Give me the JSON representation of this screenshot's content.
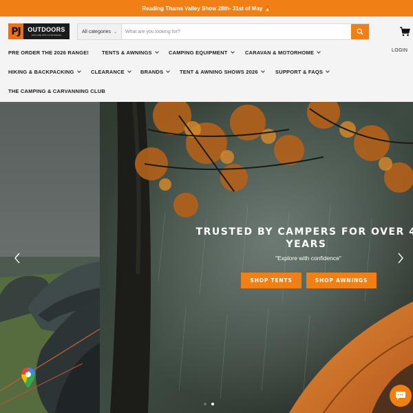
{
  "announcement": "Reading Thams Valley Show 28th- 31st of May 🔥",
  "logo": {
    "mark": "PJ",
    "name": "OUTDOORS",
    "tagline": "EXPLORE WITH CONFIDENCE"
  },
  "search": {
    "category": "All categories",
    "placeholder": "What are you looking for?"
  },
  "nav": {
    "row1": [
      "PRE ORDER THE 2026 RANGE!",
      "TENTS & AWNINGS",
      "CAMPING EQUIPMENT",
      "CARAVAN & MOTORHOME"
    ],
    "row2": [
      "HIKING & BACKPACKING",
      "CLEARANCE",
      "BRANDS",
      "TENT & AWNING SHOWS 2026",
      "SUPPORT & FAQS"
    ],
    "row3": [
      "THE CAMPING & CARVANNING CLUB"
    ],
    "login": "LOGIN"
  },
  "hero": {
    "title_line1": "TRUSTED BY CAMPERS FOR OVER 4",
    "title_line2": "YEARS",
    "subtitle": "\"Explore with confidence\"",
    "buttons": [
      "SHOP TENTS",
      "SHOP AWNINGS"
    ],
    "active_slide": 2,
    "slide_count": 2
  },
  "colors": {
    "accent": "#f07f16",
    "header_bg": "#f4f4f4"
  },
  "icons": [
    "search-icon",
    "cart-icon",
    "chevron-left-icon",
    "chevron-right-icon",
    "google-maps-pin-icon",
    "chat-icon"
  ]
}
